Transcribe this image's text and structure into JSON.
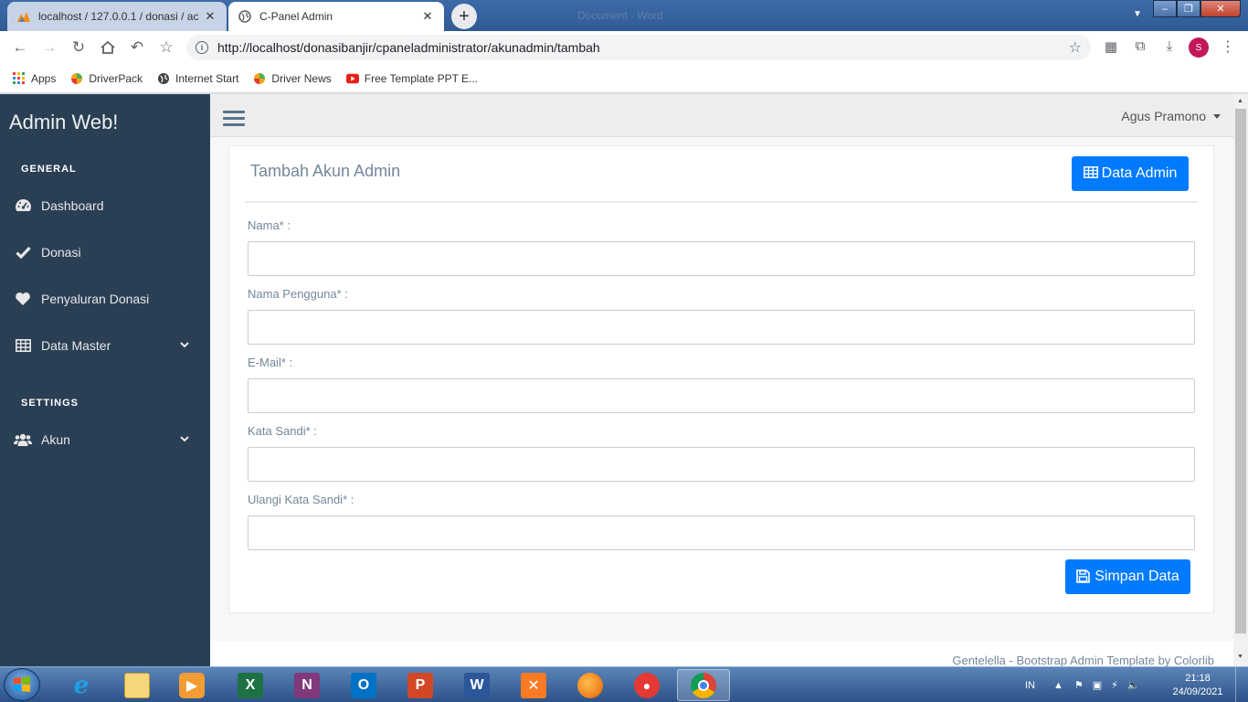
{
  "browser": {
    "tabs": [
      {
        "title": "localhost / 127.0.0.1 / donasi / ac",
        "active": false
      },
      {
        "title": "C-Panel Admin",
        "active": true
      }
    ],
    "ghost_title": "Document - Word",
    "url": "http://localhost/donasibanjir/cpaneladministrator/akunadmin/tambah",
    "profile_initial": "S",
    "bookmarks": [
      "Apps",
      "DriverPack",
      "Internet Start",
      "Driver News",
      "Free Template PPT E..."
    ]
  },
  "sidebar": {
    "brand": "Admin Web!",
    "sections": [
      {
        "title": "GENERAL",
        "items": [
          {
            "label": "Dashboard",
            "icon": "dashboard-icon"
          },
          {
            "label": "Donasi",
            "icon": "check-icon"
          },
          {
            "label": "Penyaluran Donasi",
            "icon": "heart-icon"
          },
          {
            "label": "Data Master",
            "icon": "table-icon",
            "has_submenu": true
          }
        ]
      },
      {
        "title": "SETTINGS",
        "items": [
          {
            "label": "Akun",
            "icon": "users-icon",
            "has_submenu": true
          }
        ]
      }
    ]
  },
  "topnav": {
    "user_name": "Agus Pramono"
  },
  "panel": {
    "title": "Tambah Akun Admin",
    "data_admin_button": "Data Admin",
    "fields": [
      {
        "label": "Nama* :",
        "value": ""
      },
      {
        "label": "Nama Pengguna* :",
        "value": ""
      },
      {
        "label": "E-Mail* :",
        "value": ""
      },
      {
        "label": "Kata Sandi* :",
        "value": ""
      },
      {
        "label": "Ulangi Kata Sandi* :",
        "value": ""
      }
    ],
    "submit_button": "Simpan Data"
  },
  "footer": {
    "text": "Gentelella - Bootstrap Admin Template by Colorlib"
  },
  "taskbar": {
    "apps": [
      "Internet Explorer",
      "File Explorer",
      "Media Player",
      "Excel",
      "OneNote",
      "Outlook",
      "PowerPoint",
      "Word",
      "XAMPP",
      "Firefox",
      "Toolbox",
      "Chrome"
    ],
    "active_app": "Chrome",
    "language": "IN",
    "time": "21:18",
    "date": "24/09/2021"
  },
  "colors": {
    "sidebar_bg": "#2A3F54",
    "primary": "#007bff",
    "page_bg": "#F7F7F7",
    "topnav_bg": "#EDEDED",
    "muted_text": "#73879C"
  }
}
